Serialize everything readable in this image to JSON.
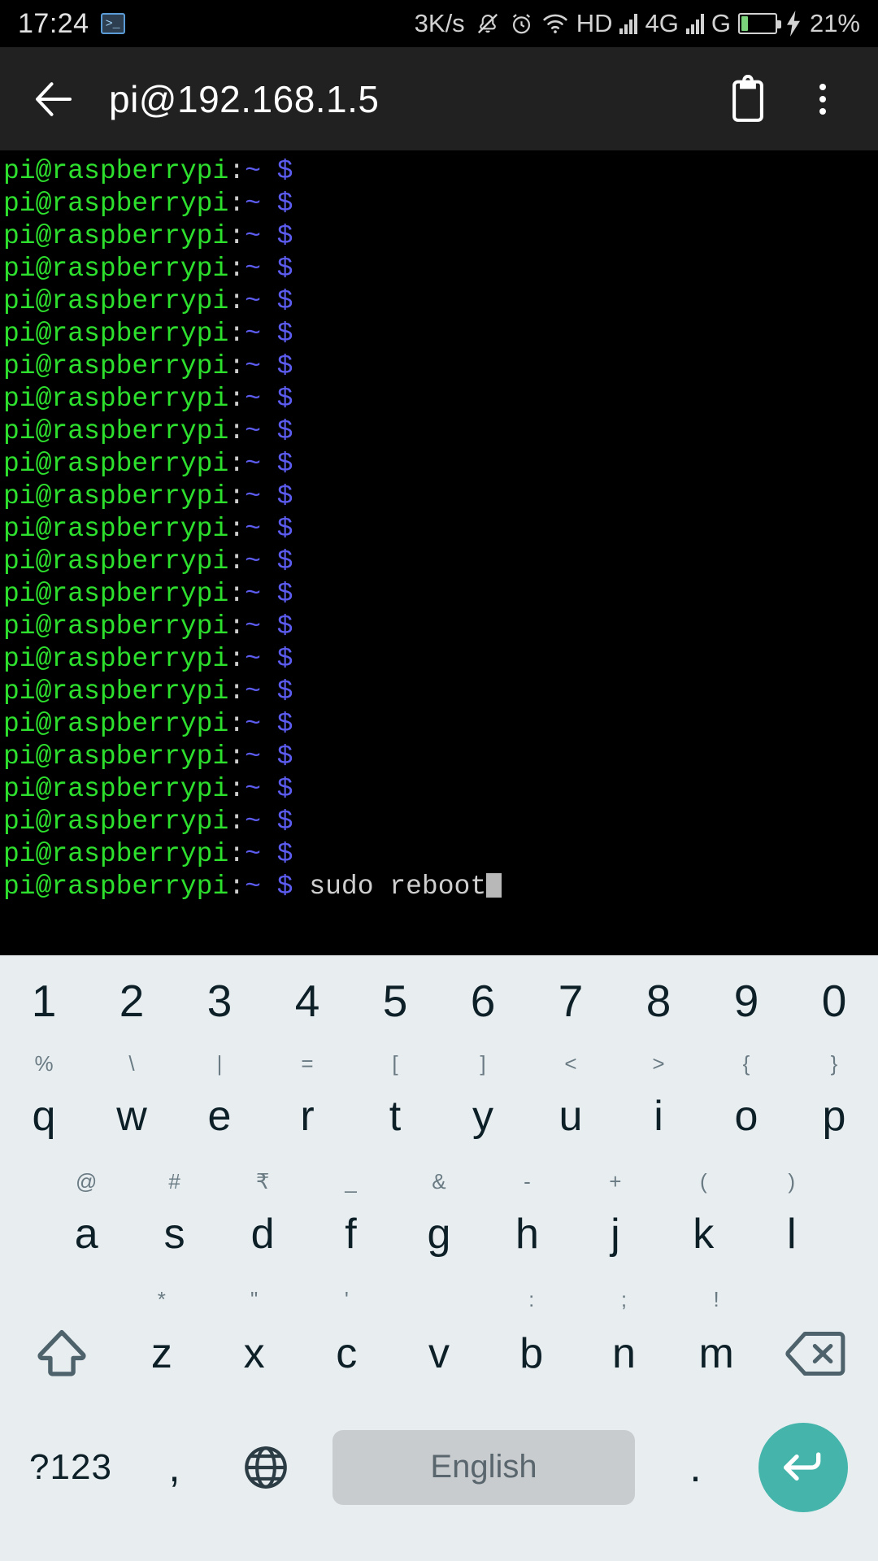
{
  "status_bar": {
    "clock": "17:24",
    "terminal_icon_glyph": ">_",
    "network_speed": "3K/s",
    "hd_label": "HD",
    "network_type": "4G",
    "gprs_label": "G",
    "battery_percent": "21%",
    "battery_level": 21,
    "icons": [
      "terminal-icon",
      "bell-muted-icon",
      "alarm-clock-icon",
      "wifi-icon",
      "signal-bars-icon",
      "signal-bars-2-icon",
      "battery-icon",
      "charging-bolt-icon"
    ],
    "colors": {
      "battery_fill": "#7bd37b",
      "text": "#d2d2d2"
    }
  },
  "app_bar": {
    "title": "pi@192.168.1.5",
    "back_label": "back-arrow",
    "clipboard_label": "clipboard",
    "overflow_label": "more-options",
    "background": "#212121"
  },
  "terminal": {
    "prompt_user_host": "pi@raspberrypi",
    "prompt_colon": ":",
    "prompt_path": "~",
    "prompt_symbol": "$",
    "colors": {
      "user_host": "#2ee02e",
      "path": "#5c5cf0",
      "symbol": "#5c5cf0",
      "command": "#cfcfcf",
      "background": "#000000"
    },
    "lines": [
      {
        "command": ""
      },
      {
        "command": ""
      },
      {
        "command": ""
      },
      {
        "command": ""
      },
      {
        "command": ""
      },
      {
        "command": ""
      },
      {
        "command": ""
      },
      {
        "command": ""
      },
      {
        "command": ""
      },
      {
        "command": ""
      },
      {
        "command": ""
      },
      {
        "command": ""
      },
      {
        "command": ""
      },
      {
        "command": ""
      },
      {
        "command": ""
      },
      {
        "command": ""
      },
      {
        "command": ""
      },
      {
        "command": ""
      },
      {
        "command": ""
      },
      {
        "command": ""
      },
      {
        "command": ""
      },
      {
        "command": ""
      },
      {
        "command": "sudo reboot",
        "cursor": true
      }
    ],
    "current_command": "sudo reboot"
  },
  "keyboard": {
    "language": "English",
    "symbols_key": "?123",
    "comma_key": ",",
    "period_key": ".",
    "rows": {
      "numbers": [
        {
          "main": "1"
        },
        {
          "main": "2"
        },
        {
          "main": "3"
        },
        {
          "main": "4"
        },
        {
          "main": "5"
        },
        {
          "main": "6"
        },
        {
          "main": "7"
        },
        {
          "main": "8"
        },
        {
          "main": "9"
        },
        {
          "main": "0"
        }
      ],
      "top": [
        {
          "main": "q",
          "sub": "%"
        },
        {
          "main": "w",
          "sub": "\\"
        },
        {
          "main": "e",
          "sub": "|"
        },
        {
          "main": "r",
          "sub": "="
        },
        {
          "main": "t",
          "sub": "["
        },
        {
          "main": "y",
          "sub": "]"
        },
        {
          "main": "u",
          "sub": "<"
        },
        {
          "main": "i",
          "sub": ">"
        },
        {
          "main": "o",
          "sub": "{"
        },
        {
          "main": "p",
          "sub": "}"
        }
      ],
      "home": [
        {
          "main": "a",
          "sub": "@"
        },
        {
          "main": "s",
          "sub": "#"
        },
        {
          "main": "d",
          "sub": "₹"
        },
        {
          "main": "f",
          "sub": "_"
        },
        {
          "main": "g",
          "sub": "&"
        },
        {
          "main": "h",
          "sub": "-"
        },
        {
          "main": "j",
          "sub": "+"
        },
        {
          "main": "k",
          "sub": "("
        },
        {
          "main": "l",
          "sub": ")"
        }
      ],
      "bottom": [
        {
          "main": "z",
          "sub": "*"
        },
        {
          "main": "x",
          "sub": "\""
        },
        {
          "main": "c",
          "sub": "'"
        },
        {
          "main": "v",
          "sub": ""
        },
        {
          "main": "b",
          "sub": ":"
        },
        {
          "main": "n",
          "sub": ";"
        },
        {
          "main": "m",
          "sub": "!"
        }
      ]
    },
    "colors": {
      "background": "#e8edf0",
      "key_text": "#0d2028",
      "sub_text": "#6a7b84",
      "spacebar": "#c8cccf",
      "enter": "#45b5ac"
    }
  }
}
